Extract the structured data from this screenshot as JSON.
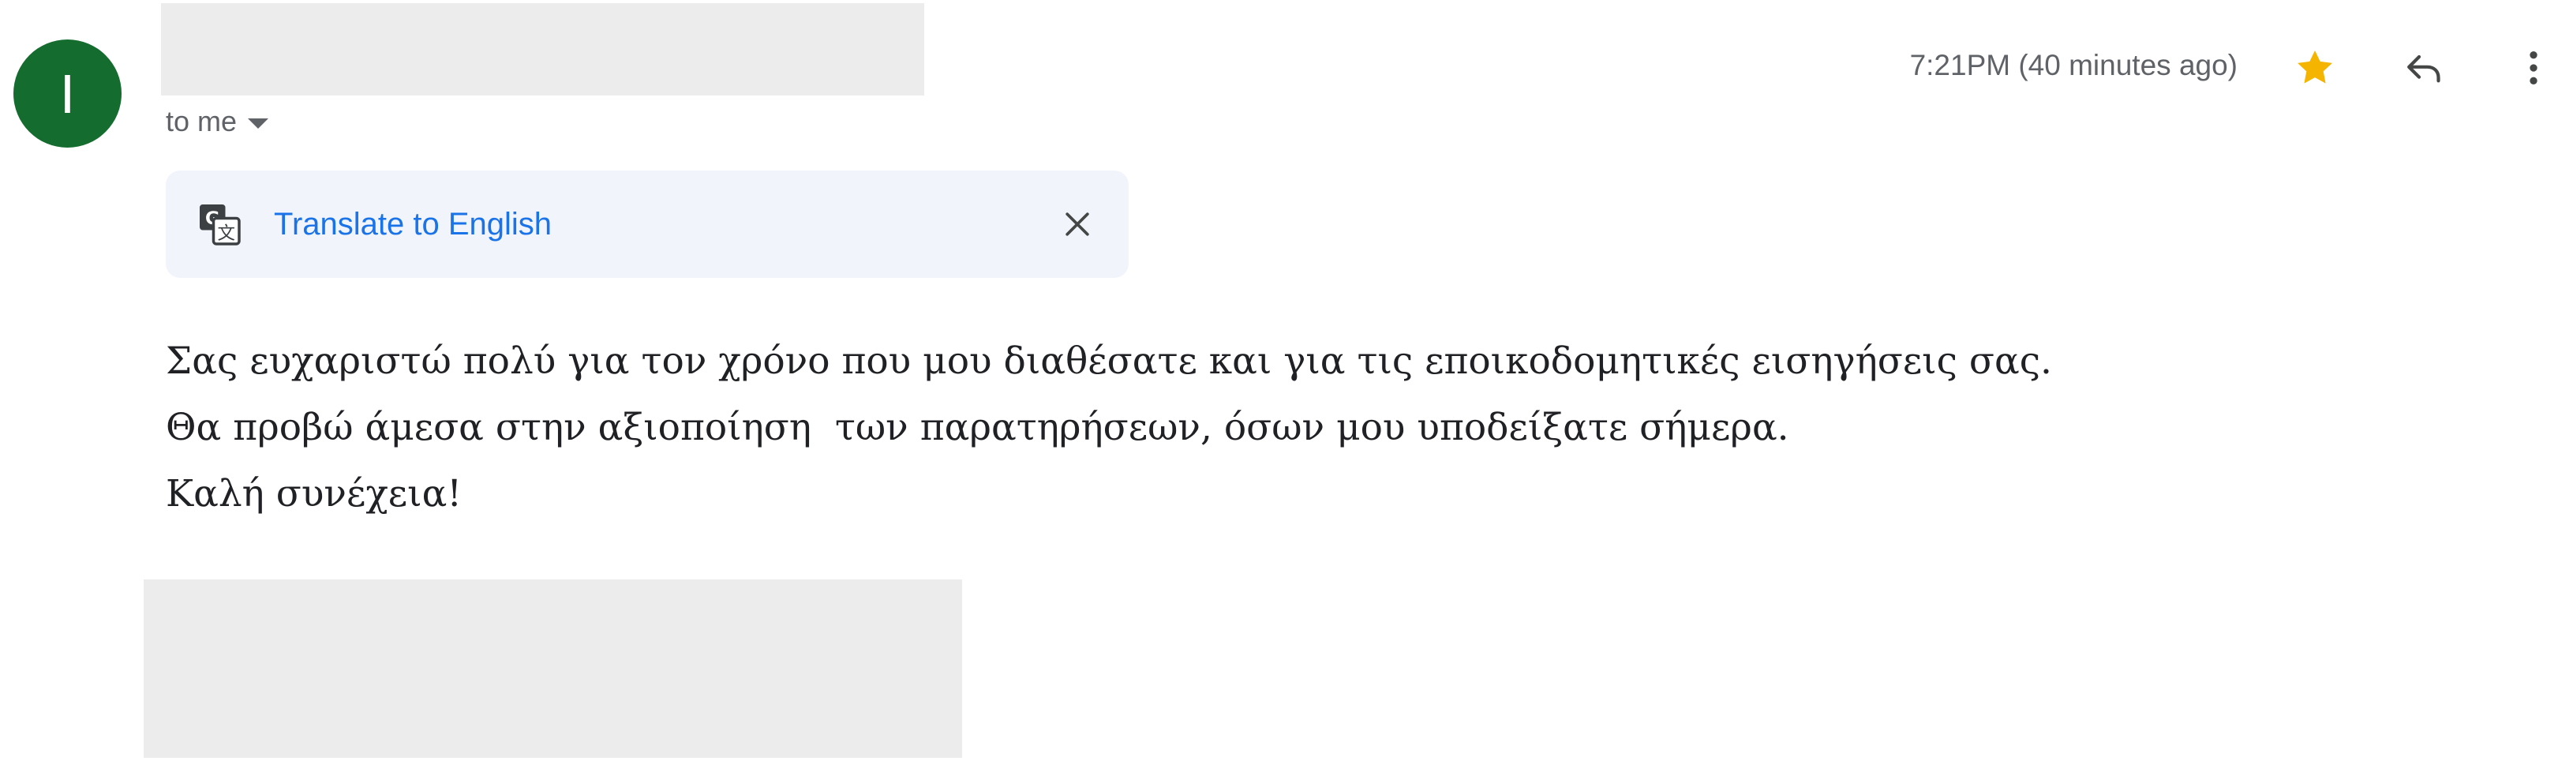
{
  "sender": {
    "avatar_letter": "I",
    "avatar_color": "#146c2e",
    "recipient_label": "to me"
  },
  "header": {
    "timestamp": "7:21PM (40 minutes ago)",
    "icons": [
      "star-icon",
      "reply-icon",
      "more-vert-icon"
    ],
    "star_color": "#f4b400"
  },
  "translate": {
    "icon": "translate-icon",
    "link_label": "Translate to English",
    "link_color": "#1a73e8",
    "close_icon": "close-icon"
  },
  "message": {
    "lines": [
      "Σας ευχαριστώ πολύ για τον χρόνο που μου διαθέσατε και για τις εποικοδομητικές εισηγήσεις σας.",
      "Θα προβώ άμεσα στην αξιοποίηση  των παρατηρήσεων, όσων μου υποδείξατε σήμερα.",
      "Καλή συνέχεια!"
    ]
  }
}
